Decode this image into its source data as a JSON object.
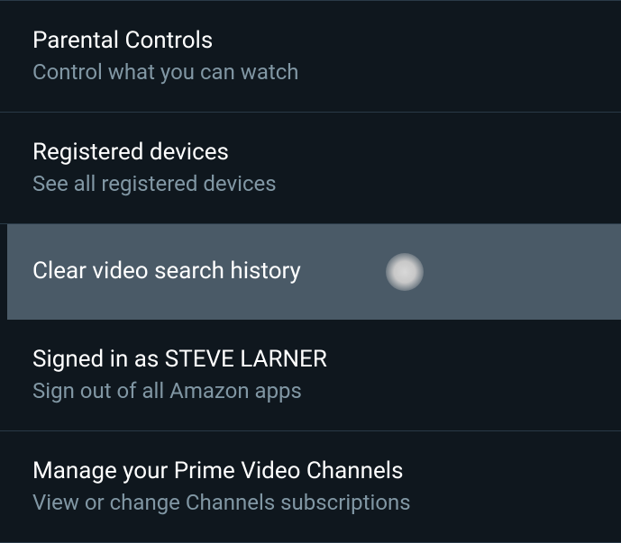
{
  "settings": {
    "items": [
      {
        "title": "Parental Controls",
        "subtitle": "Control what you can watch"
      },
      {
        "title": "Registered devices",
        "subtitle": "See all registered devices"
      },
      {
        "title": "Clear video search history"
      },
      {
        "title": "Signed in as STEVE LARNER",
        "subtitle": "Sign out of all Amazon apps"
      },
      {
        "title": "Manage your Prime Video Channels",
        "subtitle": "View or change Channels subscriptions"
      }
    ]
  }
}
